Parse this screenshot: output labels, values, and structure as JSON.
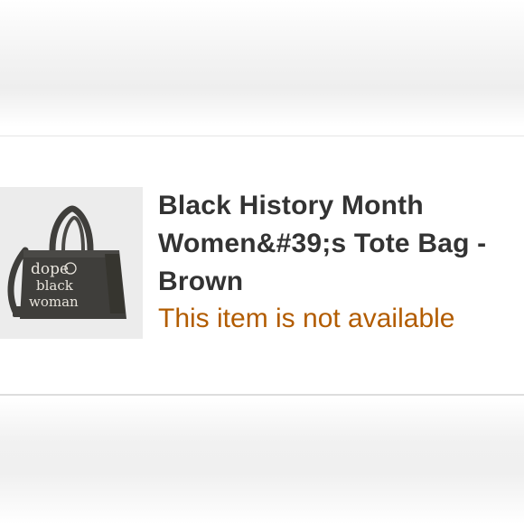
{
  "product": {
    "title": "Black History Month Women&#39;s Tote Bag - Brown",
    "availability": "This item is not available",
    "image_icon": "tote-bag-image",
    "bag_print": [
      "dope",
      "black",
      "woman"
    ]
  },
  "colors": {
    "availability_text": "#b25c00",
    "title_text": "#333333",
    "bag": "#3f3e3b",
    "bag_print": "#e8e4dc"
  }
}
